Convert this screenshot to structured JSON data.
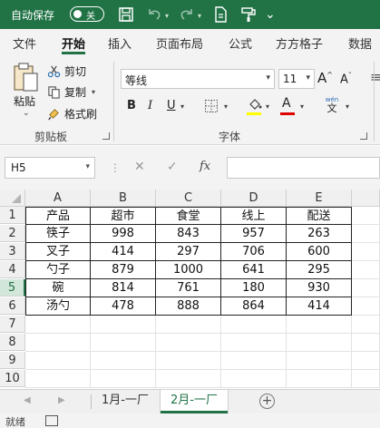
{
  "titlebar": {
    "autosave_label": "自动保存",
    "autosave_state": "关",
    "accent_color": "#217346",
    "icons": [
      "save-icon",
      "undo-icon",
      "redo-icon",
      "document-icon",
      "paint-format-icon",
      "overflow-icon"
    ]
  },
  "ribbon_tabs": [
    "文件",
    "开始",
    "插入",
    "页面布局",
    "公式",
    "方方格子",
    "数据"
  ],
  "active_tab": "开始",
  "clipboard": {
    "paste_label": "粘贴",
    "cut_label": "剪切",
    "copy_label": "复制",
    "format_painter_label": "格式刷",
    "group_label": "剪贴板"
  },
  "font_group": {
    "font_name": "等线",
    "font_size": "11",
    "grow_label": "A",
    "shrink_label": "A",
    "bold_label": "B",
    "italic_label": "I",
    "underline_label": "U",
    "phonetic_label": "wén",
    "phonetic_char": "文",
    "group_label": "字体",
    "fill_color": "#ffff00",
    "font_color": "#e00000"
  },
  "formula_bar": {
    "name_box": "H5",
    "fx_label": "fx",
    "formula": ""
  },
  "grid": {
    "columns": [
      "A",
      "B",
      "C",
      "D",
      "E"
    ],
    "rows": [
      "1",
      "2",
      "3",
      "4",
      "5",
      "6",
      "7",
      "8",
      "9",
      "10"
    ],
    "selected_row": "5",
    "data": [
      [
        "产品",
        "超市",
        "食堂",
        "线上",
        "配送"
      ],
      [
        "筷子",
        "998",
        "843",
        "957",
        "263"
      ],
      [
        "叉子",
        "414",
        "297",
        "706",
        "600"
      ],
      [
        "勺子",
        "879",
        "1000",
        "641",
        "295"
      ],
      [
        "碗",
        "814",
        "761",
        "180",
        "930"
      ],
      [
        "汤勺",
        "478",
        "888",
        "864",
        "414"
      ]
    ]
  },
  "sheets": {
    "tabs": [
      "1月-一厂",
      "2月-一厂"
    ],
    "active": "2月-一厂",
    "add_label": "+",
    "overflow": "..."
  },
  "status": {
    "ready_text": "就绪"
  }
}
